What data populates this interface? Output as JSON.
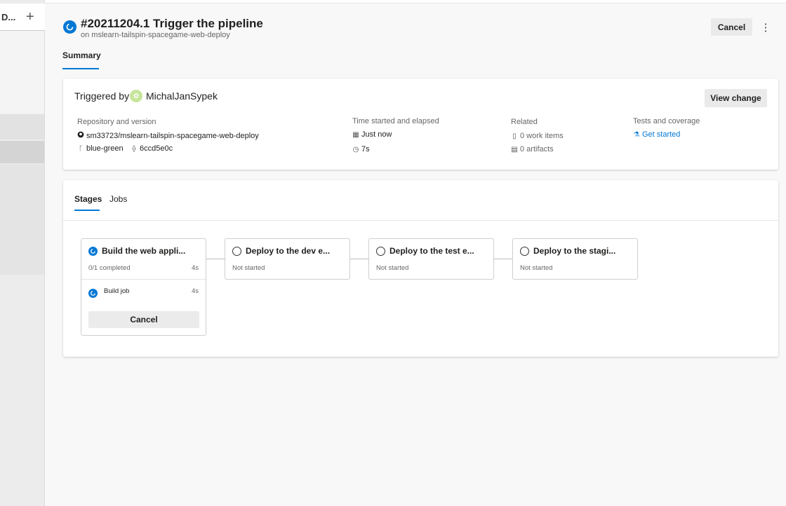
{
  "sidebar": {
    "title": "D...",
    "add_label": "+"
  },
  "header": {
    "run_title": "#20211204.1 Trigger the pipeline",
    "run_subtitle": "on mslearn-tailspin-spacegame-web-deploy",
    "cancel_label": "Cancel",
    "more_label": "⋮",
    "tabs": [
      {
        "label": "Summary",
        "selected": true
      }
    ]
  },
  "summary": {
    "triggered_by_label": "Triggered by",
    "user": "MichalJanSypek",
    "view_change_label": "View change",
    "repo": {
      "heading": "Repository and version",
      "name": "sm33723/mslearn-tailspin-spacegame-web-deploy",
      "branch": "blue-green",
      "commit": "6ccd5e0c"
    },
    "time": {
      "heading": "Time started and elapsed",
      "started": "Just now",
      "elapsed": "7s"
    },
    "related": {
      "heading": "Related",
      "work_items": "0 work items",
      "artifacts": "0 artifacts"
    },
    "tests": {
      "heading": "Tests and coverage",
      "link": "Get started"
    }
  },
  "stages_panel": {
    "tabs": [
      {
        "label": "Stages",
        "selected": true
      },
      {
        "label": "Jobs",
        "selected": false
      }
    ],
    "stages": [
      {
        "name": "Build the web appli...",
        "status": "0/1 completed",
        "time": "4s",
        "state": "running",
        "job": {
          "name": "Build job",
          "time": "4s"
        },
        "cancel_label": "Cancel"
      },
      {
        "name": "Deploy to the dev e...",
        "status": "Not started",
        "time": "",
        "state": "pending"
      },
      {
        "name": "Deploy to the test e...",
        "status": "Not started",
        "time": "",
        "state": "pending"
      },
      {
        "name": "Deploy to the stagi...",
        "status": "Not started",
        "time": "",
        "state": "pending"
      }
    ]
  },
  "colors": {
    "accent": "#0078d4",
    "running": "#0078d4",
    "avatar": "#c7e59b"
  },
  "icons": {
    "run_status": "running-icon",
    "repo": "github-icon",
    "branch": "branch-icon",
    "commit": "commit-icon",
    "calendar": "calendar-icon",
    "clock": "clock-icon",
    "work_items": "clipboard-icon",
    "artifacts": "artifact-icon",
    "tests": "flask-icon"
  }
}
